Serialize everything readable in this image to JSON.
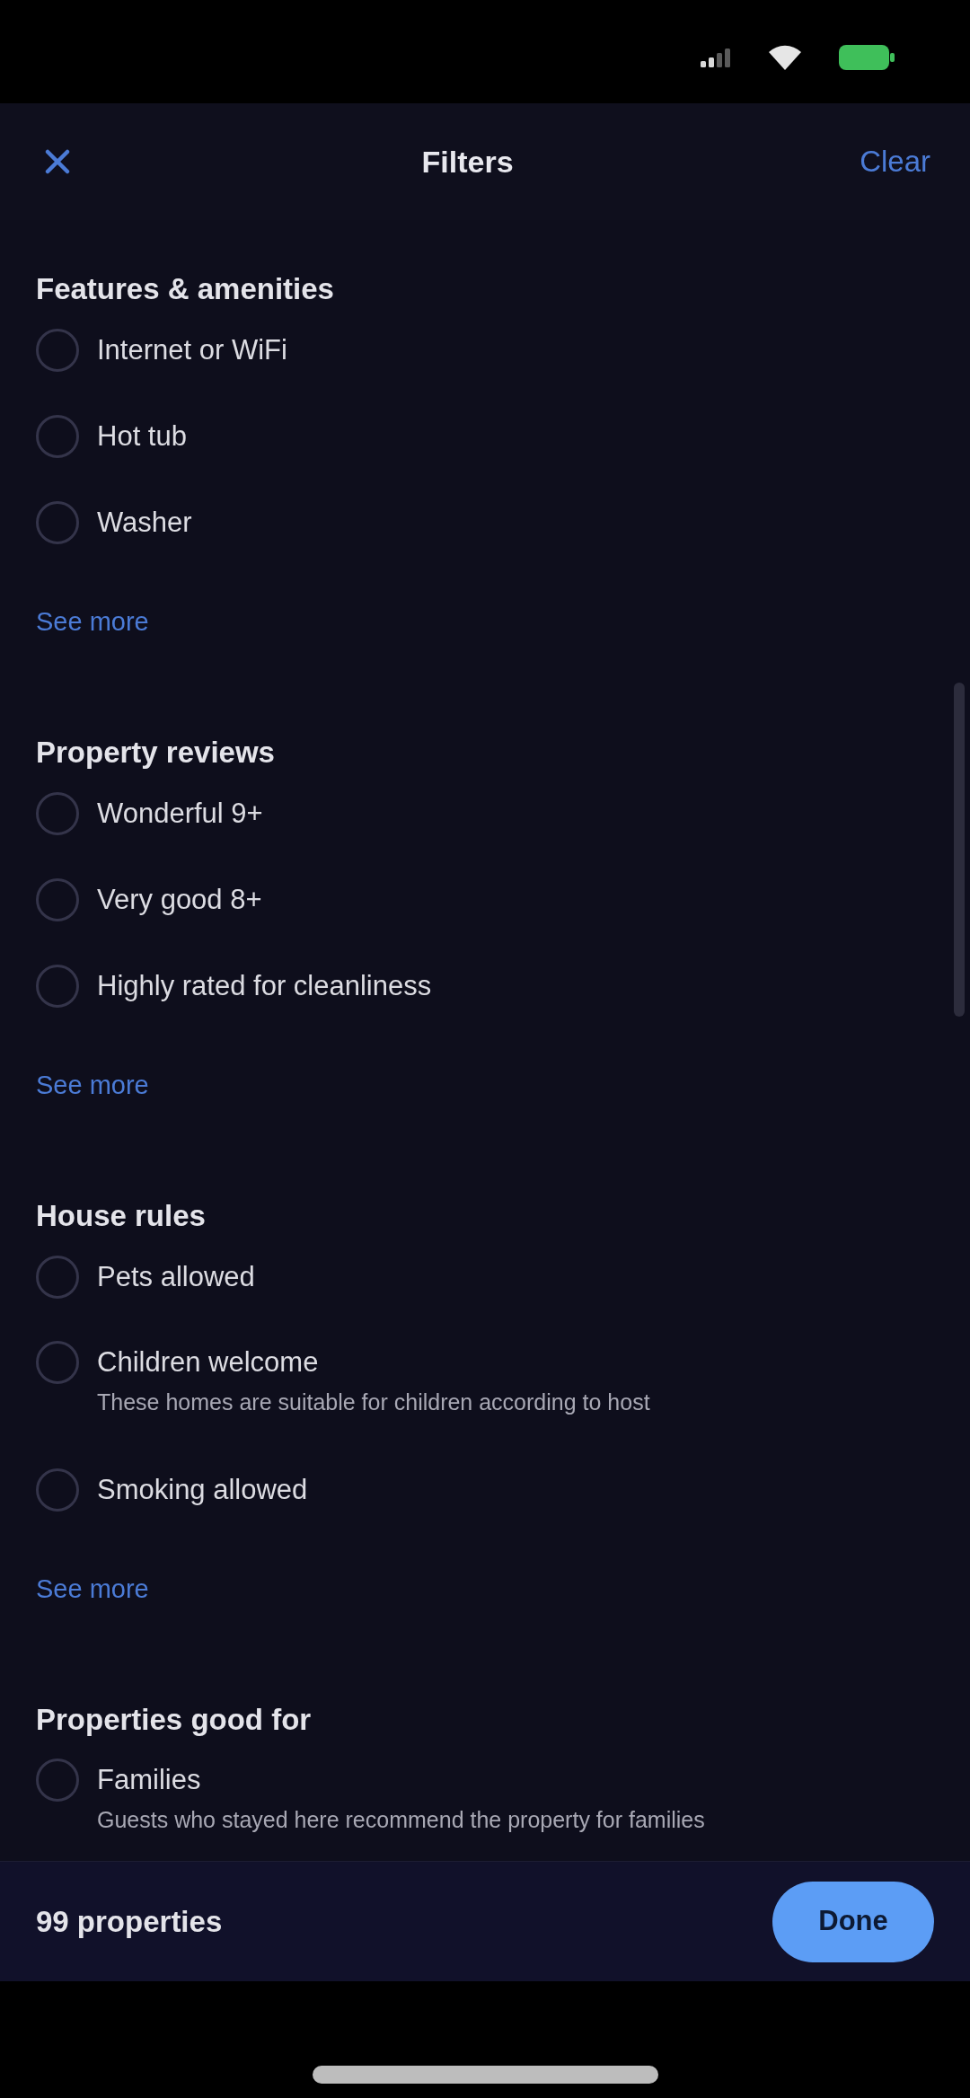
{
  "header": {
    "title": "Filters",
    "action": "Clear"
  },
  "sections": [
    {
      "title": "Features & amenities",
      "options": [
        {
          "label": "Internet or WiFi",
          "checked": false
        },
        {
          "label": "Hot tub",
          "checked": false
        },
        {
          "label": "Washer",
          "checked": false
        }
      ],
      "see_more": "See more"
    },
    {
      "title": "Property reviews",
      "options": [
        {
          "label": "Wonderful 9+",
          "checked": false
        },
        {
          "label": "Very good 8+",
          "checked": false
        },
        {
          "label": "Highly rated for cleanliness",
          "checked": false
        }
      ],
      "see_more": "See more"
    },
    {
      "title": "House rules",
      "options": [
        {
          "label": "Pets allowed",
          "checked": false
        },
        {
          "label": "Children welcome",
          "description": "These homes are suitable for children according to host",
          "checked": false
        },
        {
          "label": "Smoking allowed",
          "checked": false
        }
      ],
      "see_more": "See more"
    },
    {
      "title": "Properties good for",
      "options": [
        {
          "label": "Families",
          "description": "Guests who stayed here recommend the property for families",
          "checked": false
        }
      ]
    }
  ],
  "footer": {
    "count": "99 properties",
    "button": "Done"
  }
}
